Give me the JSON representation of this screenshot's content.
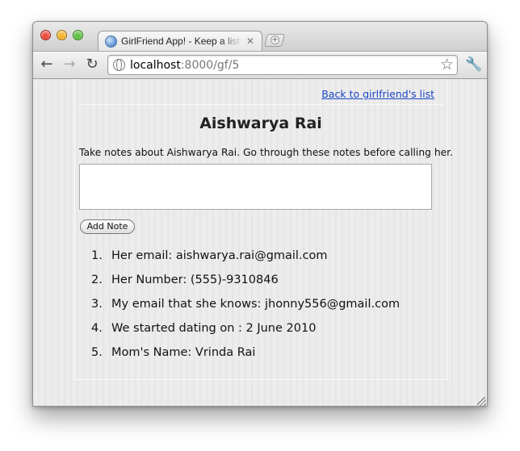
{
  "browser": {
    "tab_title": "GirlFriend App! - Keep a list of your girlfriends",
    "tab_close": "✕",
    "url_host": "localhost",
    "url_rest": ":8000/gf/5",
    "icons": [
      "back-arrow-icon",
      "forward-arrow-icon",
      "reload-icon",
      "globe-icon",
      "star-icon",
      "wrench-icon"
    ],
    "traffic_lights": [
      "#ec4b3f",
      "#f5b332",
      "#62c244"
    ]
  },
  "page": {
    "back_link": "Back to girlfriend's list",
    "title": "Aishwarya Rai",
    "instructions": "Take notes about Aishwarya Rai. Go through these notes before calling her.",
    "note_value": "",
    "add_note_label": "Add Note",
    "notes": [
      {
        "num": "1.",
        "text": "Her email: aishwarya.rai@gmail.com"
      },
      {
        "num": "2.",
        "text": "Her Number: (555)-9310846"
      },
      {
        "num": "3.",
        "text": "My email that she knows: jhonny556@gmail.com"
      },
      {
        "num": "4.",
        "text": "We started dating on : 2 June 2010"
      },
      {
        "num": "5.",
        "text": "Mom's Name: Vrinda Rai"
      }
    ]
  }
}
